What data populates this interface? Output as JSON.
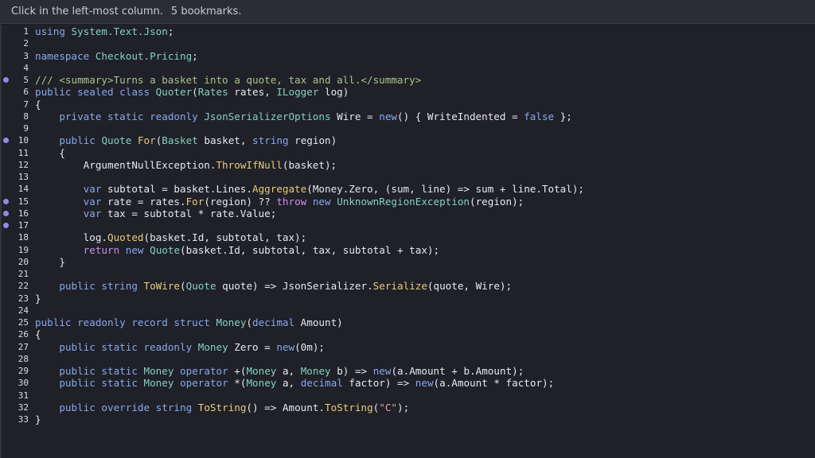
{
  "infobar": {
    "instruction": "Click in the left-most column.",
    "bookmarks": "5 bookmarks."
  },
  "colors": {
    "keyword": "#86a9ec",
    "function": "#e8cc78",
    "type": "#82d2bf",
    "comment": "#a8c48a",
    "string": "#e6a39a",
    "control": "#c792ea",
    "default": "#e8e9ed",
    "bookmark": "#8e8ce4"
  },
  "editor": {
    "lines": [
      {
        "n": "1",
        "bookmark": false,
        "tokens": [
          [
            "kw",
            "using"
          ],
          [
            "df",
            " "
          ],
          [
            "ty",
            "System.Text.Json"
          ],
          [
            "df",
            ";"
          ]
        ]
      },
      {
        "n": "2",
        "bookmark": false,
        "tokens": []
      },
      {
        "n": "3",
        "bookmark": false,
        "tokens": [
          [
            "kw",
            "namespace"
          ],
          [
            "df",
            " "
          ],
          [
            "ty",
            "Checkout.Pricing"
          ],
          [
            "df",
            ";"
          ]
        ]
      },
      {
        "n": "4",
        "bookmark": false,
        "tokens": []
      },
      {
        "n": "5",
        "bookmark": true,
        "tokens": [
          [
            "cm",
            "/// <summary>Turns a basket into a quote, tax and all.</summary>"
          ]
        ]
      },
      {
        "n": "6",
        "bookmark": false,
        "tokens": [
          [
            "kw",
            "public sealed class"
          ],
          [
            "df",
            " "
          ],
          [
            "ty",
            "Quoter"
          ],
          [
            "df",
            "("
          ],
          [
            "ty",
            "Rates"
          ],
          [
            "df",
            " rates, "
          ],
          [
            "ty",
            "ILogger"
          ],
          [
            "df",
            " log)"
          ]
        ]
      },
      {
        "n": "7",
        "bookmark": false,
        "tokens": [
          [
            "df",
            "{"
          ]
        ]
      },
      {
        "n": "8",
        "bookmark": false,
        "tokens": [
          [
            "df",
            "    "
          ],
          [
            "kw",
            "private static readonly"
          ],
          [
            "df",
            " "
          ],
          [
            "ty",
            "JsonSerializerOptions"
          ],
          [
            "df",
            " Wire = "
          ],
          [
            "kw",
            "new"
          ],
          [
            "df",
            "() { WriteIndented = "
          ],
          [
            "kw",
            "false"
          ],
          [
            "df",
            " };"
          ]
        ]
      },
      {
        "n": "9",
        "bookmark": false,
        "tokens": []
      },
      {
        "n": "10",
        "bookmark": true,
        "tokens": [
          [
            "df",
            "    "
          ],
          [
            "kw",
            "public"
          ],
          [
            "df",
            " "
          ],
          [
            "ty",
            "Quote"
          ],
          [
            "df",
            " "
          ],
          [
            "fn",
            "For"
          ],
          [
            "df",
            "("
          ],
          [
            "ty",
            "Basket"
          ],
          [
            "df",
            " basket, "
          ],
          [
            "kw",
            "string"
          ],
          [
            "df",
            " region)"
          ]
        ]
      },
      {
        "n": "11",
        "bookmark": false,
        "tokens": [
          [
            "df",
            "    {"
          ]
        ]
      },
      {
        "n": "12",
        "bookmark": false,
        "tokens": [
          [
            "df",
            "        ArgumentNullException."
          ],
          [
            "fn",
            "ThrowIfNull"
          ],
          [
            "df",
            "(basket);"
          ]
        ]
      },
      {
        "n": "13",
        "bookmark": false,
        "tokens": []
      },
      {
        "n": "14",
        "bookmark": false,
        "tokens": [
          [
            "df",
            "        "
          ],
          [
            "kw",
            "var"
          ],
          [
            "df",
            " subtotal = basket.Lines."
          ],
          [
            "fn",
            "Aggregate"
          ],
          [
            "df",
            "(Money.Zero, (sum, line) => sum + line.Total);"
          ]
        ]
      },
      {
        "n": "15",
        "bookmark": true,
        "tokens": [
          [
            "df",
            "        "
          ],
          [
            "kw",
            "var"
          ],
          [
            "df",
            " rate = rates."
          ],
          [
            "fn",
            "For"
          ],
          [
            "df",
            "(region) ?? "
          ],
          [
            "ctl",
            "throw"
          ],
          [
            "df",
            " "
          ],
          [
            "kw",
            "new"
          ],
          [
            "df",
            " "
          ],
          [
            "ty",
            "UnknownRegionException"
          ],
          [
            "df",
            "(region);"
          ]
        ]
      },
      {
        "n": "16",
        "bookmark": true,
        "tokens": [
          [
            "df",
            "        "
          ],
          [
            "kw",
            "var"
          ],
          [
            "df",
            " tax = subtotal * rate.Value;"
          ]
        ]
      },
      {
        "n": "17",
        "bookmark": true,
        "tokens": []
      },
      {
        "n": "18",
        "bookmark": false,
        "tokens": [
          [
            "df",
            "        log."
          ],
          [
            "fn",
            "Quoted"
          ],
          [
            "df",
            "(basket.Id, subtotal, tax);"
          ]
        ]
      },
      {
        "n": "19",
        "bookmark": false,
        "tokens": [
          [
            "df",
            "        "
          ],
          [
            "ctl",
            "return"
          ],
          [
            "df",
            " "
          ],
          [
            "kw",
            "new"
          ],
          [
            "df",
            " "
          ],
          [
            "ty",
            "Quote"
          ],
          [
            "df",
            "(basket.Id, subtotal, tax, subtotal + tax);"
          ]
        ]
      },
      {
        "n": "20",
        "bookmark": false,
        "tokens": [
          [
            "df",
            "    }"
          ]
        ]
      },
      {
        "n": "21",
        "bookmark": false,
        "tokens": []
      },
      {
        "n": "22",
        "bookmark": false,
        "tokens": [
          [
            "df",
            "    "
          ],
          [
            "kw",
            "public string"
          ],
          [
            "df",
            " "
          ],
          [
            "fn",
            "ToWire"
          ],
          [
            "df",
            "("
          ],
          [
            "ty",
            "Quote"
          ],
          [
            "df",
            " quote) => JsonSerializer."
          ],
          [
            "fn",
            "Serialize"
          ],
          [
            "df",
            "(quote, Wire);"
          ]
        ]
      },
      {
        "n": "23",
        "bookmark": false,
        "tokens": [
          [
            "df",
            "}"
          ]
        ]
      },
      {
        "n": "24",
        "bookmark": false,
        "tokens": []
      },
      {
        "n": "25",
        "bookmark": false,
        "tokens": [
          [
            "kw",
            "public readonly record struct"
          ],
          [
            "df",
            " "
          ],
          [
            "ty",
            "Money"
          ],
          [
            "df",
            "("
          ],
          [
            "kw",
            "decimal"
          ],
          [
            "df",
            " Amount)"
          ]
        ]
      },
      {
        "n": "26",
        "bookmark": false,
        "tokens": [
          [
            "df",
            "{"
          ]
        ]
      },
      {
        "n": "27",
        "bookmark": false,
        "tokens": [
          [
            "df",
            "    "
          ],
          [
            "kw",
            "public static readonly"
          ],
          [
            "df",
            " "
          ],
          [
            "ty",
            "Money"
          ],
          [
            "df",
            " Zero = "
          ],
          [
            "kw",
            "new"
          ],
          [
            "df",
            "(0m);"
          ]
        ]
      },
      {
        "n": "28",
        "bookmark": false,
        "tokens": []
      },
      {
        "n": "29",
        "bookmark": false,
        "tokens": [
          [
            "df",
            "    "
          ],
          [
            "kw",
            "public static"
          ],
          [
            "df",
            " "
          ],
          [
            "ty",
            "Money"
          ],
          [
            "df",
            " "
          ],
          [
            "kw",
            "operator"
          ],
          [
            "df",
            " +("
          ],
          [
            "ty",
            "Money"
          ],
          [
            "df",
            " a, "
          ],
          [
            "ty",
            "Money"
          ],
          [
            "df",
            " b) => "
          ],
          [
            "kw",
            "new"
          ],
          [
            "df",
            "(a.Amount + b.Amount);"
          ]
        ]
      },
      {
        "n": "30",
        "bookmark": false,
        "tokens": [
          [
            "df",
            "    "
          ],
          [
            "kw",
            "public static"
          ],
          [
            "df",
            " "
          ],
          [
            "ty",
            "Money"
          ],
          [
            "df",
            " "
          ],
          [
            "kw",
            "operator"
          ],
          [
            "df",
            " *("
          ],
          [
            "ty",
            "Money"
          ],
          [
            "df",
            " a, "
          ],
          [
            "kw",
            "decimal"
          ],
          [
            "df",
            " factor) => "
          ],
          [
            "kw",
            "new"
          ],
          [
            "df",
            "(a.Amount * factor);"
          ]
        ]
      },
      {
        "n": "31",
        "bookmark": false,
        "tokens": []
      },
      {
        "n": "32",
        "bookmark": false,
        "tokens": [
          [
            "df",
            "    "
          ],
          [
            "kw",
            "public override string"
          ],
          [
            "df",
            " "
          ],
          [
            "fn",
            "ToString"
          ],
          [
            "df",
            "() => Amount."
          ],
          [
            "fn",
            "ToString"
          ],
          [
            "df",
            "("
          ],
          [
            "st",
            "\"C\""
          ],
          [
            "df",
            ");"
          ]
        ]
      },
      {
        "n": "33",
        "bookmark": false,
        "tokens": [
          [
            "df",
            "}"
          ]
        ]
      }
    ]
  }
}
